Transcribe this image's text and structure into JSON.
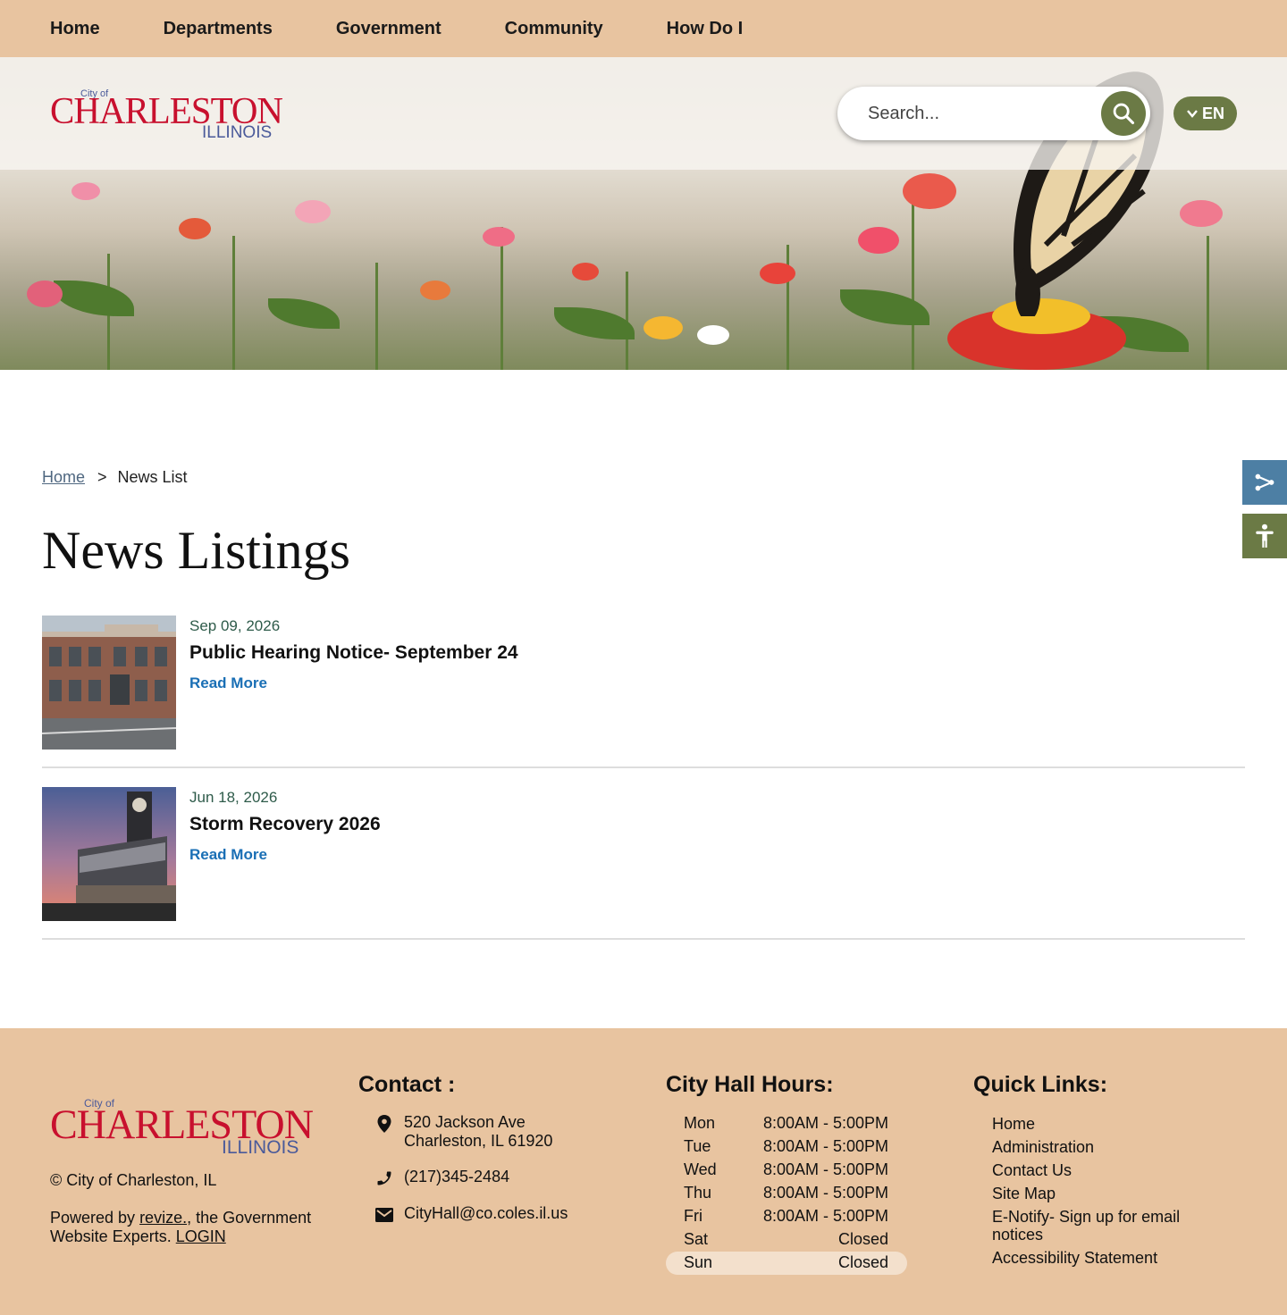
{
  "nav": {
    "items": [
      "Home",
      "Departments",
      "Government",
      "Community",
      "How Do I"
    ]
  },
  "header": {
    "logo": {
      "small": "City of",
      "main": "CHARLESTON",
      "sub": "ILLINOIS"
    },
    "search": {
      "placeholder": "Search..."
    },
    "language": {
      "label": "EN"
    }
  },
  "breadcrumb": {
    "home": "Home",
    "separator": ">",
    "current": "News List"
  },
  "page": {
    "title": "News Listings"
  },
  "news": [
    {
      "date": "Sep 09, 2026",
      "title": "Public Hearing Notice- September 24",
      "link": "Read More"
    },
    {
      "date": "Jun 18, 2026",
      "title": "Storm Recovery 2026",
      "link": "Read More"
    }
  ],
  "footer": {
    "copyright": "© City of Charleston, IL",
    "powered": {
      "prefix": "Powered by ",
      "brand": "revize.",
      "suffix": ", the Government Website Experts. ",
      "login": "LOGIN"
    },
    "contact": {
      "heading": "Contact :",
      "address_line1": "520 Jackson Ave",
      "address_line2": "Charleston, IL 61920",
      "phone": "(217)345-2484",
      "email": "CityHall@co.coles.il.us"
    },
    "hours": {
      "heading": "City Hall Hours:",
      "rows": [
        {
          "day": "Mon",
          "time": "8:00AM - 5:00PM"
        },
        {
          "day": "Tue",
          "time": "8:00AM - 5:00PM"
        },
        {
          "day": "Wed",
          "time": "8:00AM - 5:00PM"
        },
        {
          "day": "Thu",
          "time": "8:00AM - 5:00PM"
        },
        {
          "day": "Fri",
          "time": "8:00AM - 5:00PM"
        },
        {
          "day": "Sat",
          "time": "Closed"
        },
        {
          "day": "Sun",
          "time": "Closed"
        }
      ]
    },
    "quick_links": {
      "heading": "Quick Links:",
      "items": [
        "Home",
        "Administration",
        "Contact Us",
        "Site Map",
        "E-Notify- Sign up for email notices",
        "Accessibility Statement"
      ]
    }
  },
  "colors": {
    "nav_bg": "#e8c4a0",
    "accent_green": "#6b7a45",
    "share_blue": "#4d7fa4",
    "logo_red": "#c8102e",
    "logo_blue": "#4a5a9a",
    "link_blue": "#1a6fb5"
  }
}
